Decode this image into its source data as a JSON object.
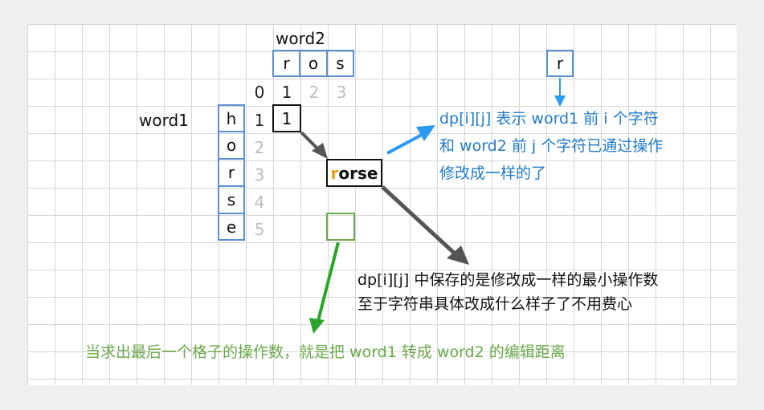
{
  "word2": {
    "label": "word2",
    "letters": [
      "r",
      "o",
      "s"
    ]
  },
  "word1": {
    "label": "word1",
    "letters": [
      "h",
      "o",
      "r",
      "s",
      "e"
    ]
  },
  "col_indices": [
    "0",
    "1",
    "2",
    "3"
  ],
  "row_indices": [
    "1",
    "2",
    "3",
    "4",
    "5"
  ],
  "single_letter": "r",
  "selected_cell_value": "1",
  "rorse": {
    "highlight": "r",
    "rest": "orse"
  },
  "note_blue": [
    "dp[i][j] 表示 word1 前 i 个字符",
    "和 word2 前 j 个字符已通过操作",
    "修改成一样的了"
  ],
  "note_dark": [
    "dp[i][j] 中保存的是修改成一样的最小操作数",
    "至于字符串具体改成什么样子了不用费心"
  ],
  "note_green": "当求出最后一个格子的操作数，就是把 word1 转成 word2 的编辑距离",
  "colors": {
    "blue_border": "#5b8fd0",
    "blue_arrow": "#2b9af3",
    "blue_text": "#1f7bc9",
    "green": "#6aa94a",
    "green_arrow": "#2aa52a",
    "dark_arrow": "#555555",
    "highlight_letter": "#e0a21a",
    "light_index": "#bdbdbd"
  }
}
